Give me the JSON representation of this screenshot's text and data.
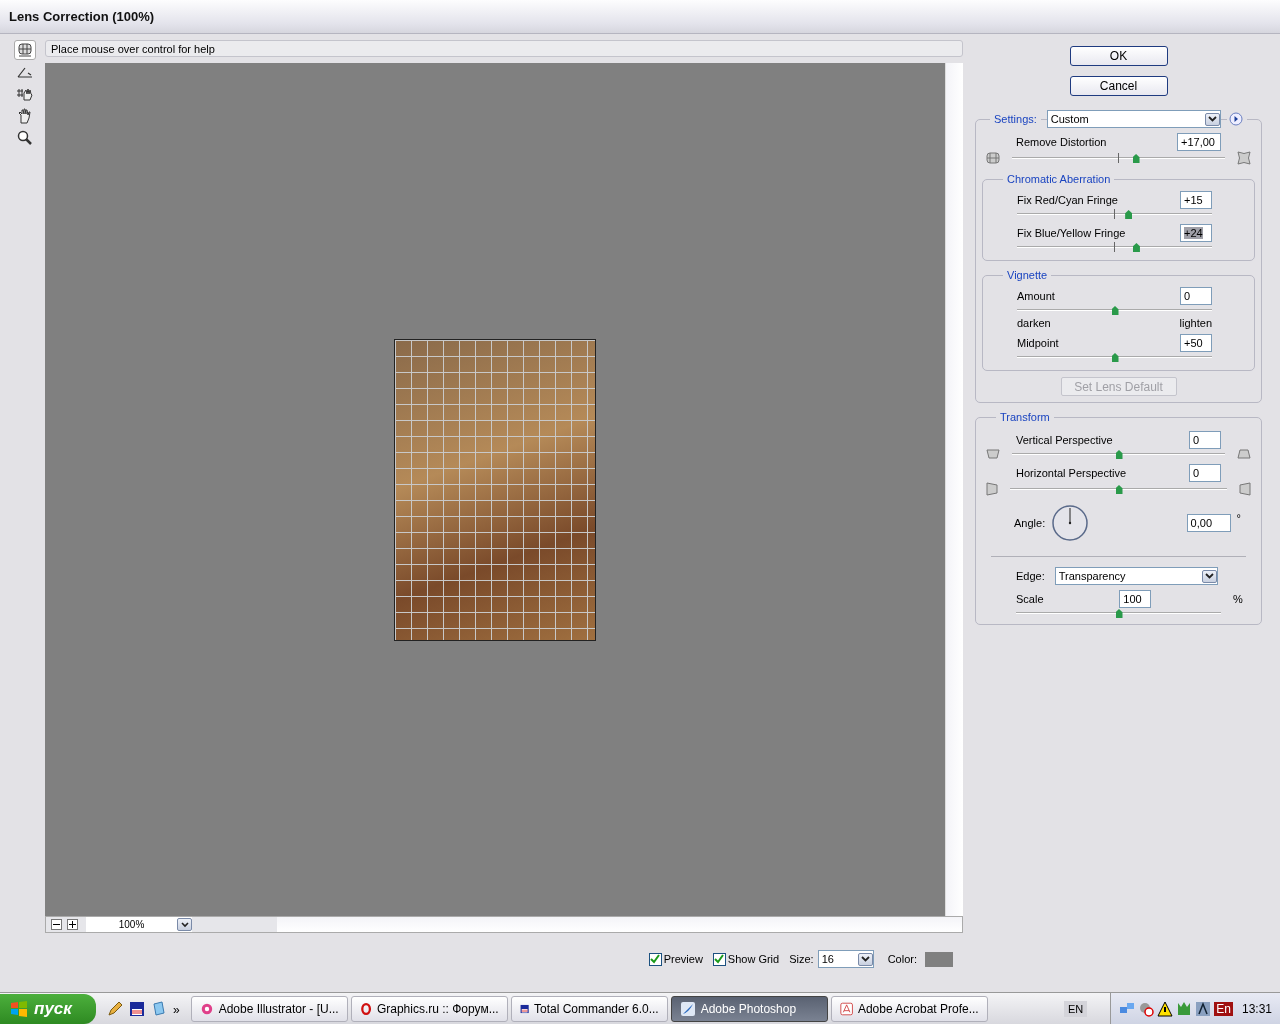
{
  "window": {
    "title": "Lens Correction (100%)"
  },
  "help_text": "Place mouse over control for help",
  "tools": [
    {
      "kind": "distortion",
      "selected": true
    },
    {
      "kind": "straighten",
      "selected": false
    },
    {
      "kind": "gridhand",
      "selected": false
    },
    {
      "kind": "hand",
      "selected": false
    },
    {
      "kind": "zoom",
      "selected": false
    }
  ],
  "zoom": {
    "value": "100%"
  },
  "buttons": [
    "OK",
    "Cancel"
  ],
  "settings": {
    "label": "Settings:",
    "value": "Custom"
  },
  "remove_distortion": {
    "label": "Remove Distortion",
    "value": "+17,00",
    "level": 0.58
  },
  "chromatic_aberration": {
    "title": "Chromatic Aberration",
    "sliders": [
      {
        "label": "Fix Red/Cyan Fringe",
        "value": "+15",
        "level": 0.57,
        "selected": false
      },
      {
        "label": "Fix Blue/Yellow Fringe",
        "value": "+24",
        "level": 0.61,
        "selected": true
      }
    ]
  },
  "vignette": {
    "title": "Vignette",
    "amount": {
      "label": "Amount",
      "value": "0",
      "level": 0.5
    },
    "left_label": "darken",
    "right_label": "lighten",
    "midpoint": {
      "label": "Midpoint",
      "value": "+50",
      "level": 0.5
    }
  },
  "set_lens_default": {
    "label": "Set Lens Default",
    "disabled": true
  },
  "transform": {
    "title": "Transform",
    "vertical": {
      "label": "Vertical Perspective",
      "value": "0",
      "level": 0.5
    },
    "horizontal": {
      "label": "Horizontal Perspective",
      "value": "0",
      "level": 0.5
    },
    "angle": {
      "label": "Angle:",
      "value": "0,00",
      "unit": "°"
    },
    "edge": {
      "label": "Edge:",
      "value": "Transparency"
    },
    "scale": {
      "label": "Scale",
      "value": "100",
      "unit": "%",
      "level": 0.5
    }
  },
  "options": {
    "preview": {
      "label": "Preview",
      "checked": true
    },
    "show_grid": {
      "label": "Show Grid",
      "checked": true
    },
    "size": {
      "label": "Size:",
      "value": "16"
    },
    "color": {
      "label": "Color:"
    }
  },
  "taskbar": {
    "start": "пуск",
    "more": "»",
    "tasks": [
      {
        "kind": "flower",
        "label": "Adobe Illustrator - [U...",
        "selected": false
      },
      {
        "kind": "opera",
        "label": "Graphics.ru :: Форум...",
        "selected": false
      },
      {
        "kind": "floppy",
        "label": "Total Commander 6.0...",
        "selected": false
      },
      {
        "kind": "feather",
        "label": "Adobe Photoshop",
        "selected": true
      },
      {
        "kind": "acrobat",
        "label": "Adobe Acrobat Profe...",
        "selected": false
      }
    ],
    "language": "EN",
    "tray_language": "En",
    "clock": "13:31"
  }
}
